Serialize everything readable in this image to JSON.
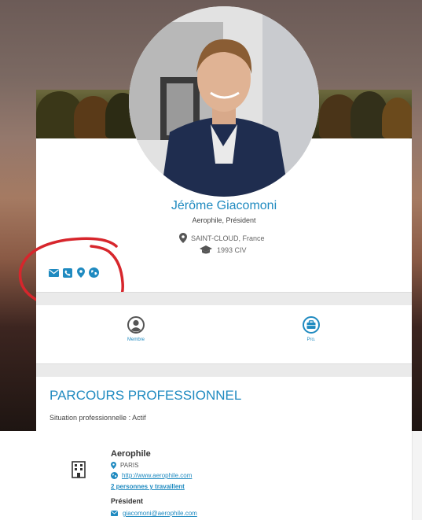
{
  "profile": {
    "name": "Jérôme Giacomoni",
    "company_role": "Aerophile, Président",
    "location": "SAINT-CLOUD, France",
    "school": "1993 CIV"
  },
  "contact_icons": [
    "envelope-icon",
    "phone-icon",
    "map-pin-icon",
    "globe-icon"
  ],
  "tabs": [
    {
      "label": "Membre",
      "icon": "user-icon"
    },
    {
      "label": "Pro.",
      "icon": "briefcase-icon"
    }
  ],
  "section": {
    "title": "PARCOURS PROFESSIONNEL",
    "status": "Situation professionnelle : Actif"
  },
  "experience": {
    "company": "Aerophile",
    "city": "PARIS",
    "website": "http://www.aerophile.com",
    "people": "2 personnes y travaillent",
    "role": "Président",
    "email": "giacomoni@aerophile.com"
  },
  "colors": {
    "accent": "#1f8ac0",
    "annotation": "#d7262c"
  }
}
